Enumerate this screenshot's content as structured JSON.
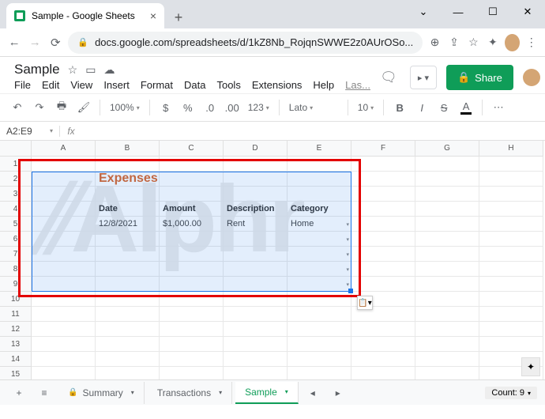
{
  "browser": {
    "tab_title": "Sample - Google Sheets",
    "url": "docs.google.com/spreadsheets/d/1kZ8Nb_RojqnSWWE2z0AUrOSo..."
  },
  "doc": {
    "title": "Sample",
    "menus": [
      "File",
      "Edit",
      "View",
      "Insert",
      "Format",
      "Data",
      "Tools",
      "Extensions",
      "Help",
      "Las..."
    ],
    "share_label": "Share"
  },
  "toolbar": {
    "zoom": "100%",
    "format_num": "123",
    "font": "Lato",
    "font_size": "10"
  },
  "namebox": "A2:E9",
  "columns": [
    "A",
    "B",
    "C",
    "D",
    "E",
    "F",
    "G",
    "H"
  ],
  "rows_visible": 16,
  "sheet": {
    "title_text": "Expenses",
    "headers": [
      "Date",
      "Amount",
      "Description",
      "Category"
    ],
    "row1": [
      "12/8/2021",
      "$1,000.00",
      "Rent",
      "Home"
    ]
  },
  "tabs": {
    "items": [
      {
        "label": "Summary",
        "locked": true,
        "active": false
      },
      {
        "label": "Transactions",
        "locked": false,
        "active": false
      },
      {
        "label": "Sample",
        "locked": false,
        "active": true
      }
    ]
  },
  "status": {
    "count_label": "Count: 9"
  },
  "watermark": "Alphr"
}
